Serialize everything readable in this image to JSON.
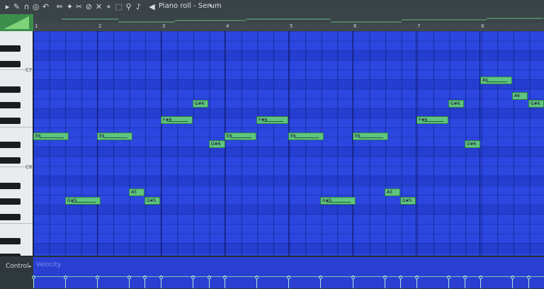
{
  "window": {
    "title": "Piano roll - Serum"
  },
  "toolbar": {
    "icons": [
      "wrench-icon",
      "magnet-icon",
      "record-icon",
      "undo-icon",
      "pencil-icon",
      "paint-icon",
      "delete-icon",
      "mute-icon",
      "slice-icon",
      "select-icon",
      "zoom-icon",
      "playback-icon"
    ]
  },
  "ruler": {
    "bars": [
      "1",
      "2",
      "3",
      "4",
      "5",
      "6",
      "7",
      "8"
    ]
  },
  "keyboard": {
    "labels": [
      "C7",
      "C6"
    ]
  },
  "notes": [
    {
      "label": "E6"
    },
    {
      "label": "G#5"
    },
    {
      "label": "E6"
    },
    {
      "label": "A5"
    },
    {
      "label": "G#5"
    },
    {
      "label": "F#6"
    },
    {
      "label": "G#6"
    },
    {
      "label": "D#6"
    },
    {
      "label": "E6"
    },
    {
      "label": "F#6"
    },
    {
      "label": "E6"
    },
    {
      "label": "G#5"
    },
    {
      "label": "E6"
    },
    {
      "label": "A5"
    },
    {
      "label": "G#5"
    },
    {
      "label": "F#6"
    },
    {
      "label": "G#6"
    },
    {
      "label": "D#6"
    },
    {
      "label": "A6"
    },
    {
      "label": "A6"
    },
    {
      "label": "G#6"
    }
  ],
  "control": {
    "label": "Control",
    "parameter": "Velocity"
  },
  "colors": {
    "grid": "#2b47e0",
    "note": "#5fc47f",
    "accent": "#3c8f4a"
  }
}
